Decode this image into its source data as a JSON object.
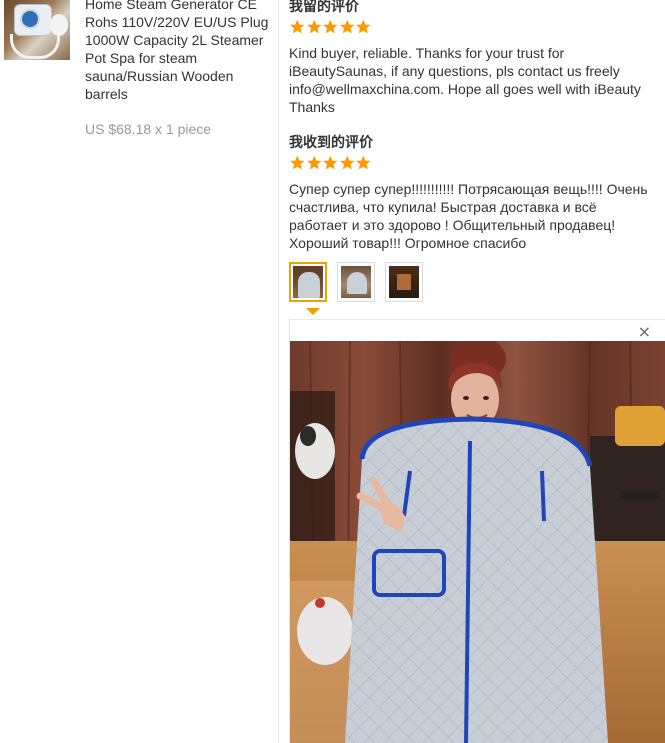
{
  "product": {
    "title": "Home Steam Generator CE Rohs 110V/220V EU/US Plug 1000W Capacity 2L Steamer Pot Spa for steam sauna/Russian Wooden barrels",
    "price": "US $68.18 x 1 piece"
  },
  "seller_feedback": {
    "heading": "我留的评价",
    "rating": 5,
    "text": "Kind buyer, reliable. Thanks for your trust for iBeautySaunas, if any questions, pls contact us freely info@wellmaxchina.com. Hope all goes well with iBeauty Thanks"
  },
  "received_feedback": {
    "heading": "我收到的评价",
    "rating": 5,
    "text": "Супер супер супер!!!!!!!!!!! Потрясающая вещь!!!! Очень счастлива, что купила! Быстрая доставка и всё работает и это здорово ! Общительный продавец! Хороший товар!!! Огромное спасибо"
  },
  "photos": {
    "count": 3,
    "selected_index": 0,
    "close_icon": "×"
  },
  "colors": {
    "star": "#ff9900",
    "active_border": "#f0a100",
    "tent_silver": "#c8ced6",
    "zipper_blue": "#1f45b8"
  }
}
